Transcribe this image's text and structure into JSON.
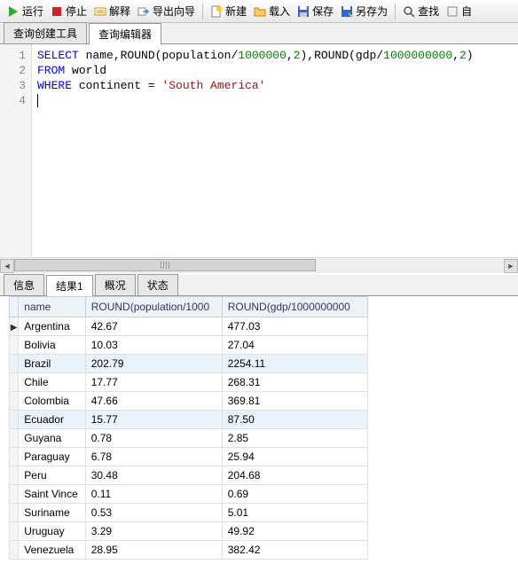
{
  "toolbar": {
    "run": "运行",
    "stop": "停止",
    "explain": "解释",
    "export_wizard": "导出向导",
    "new": "新建",
    "load": "载入",
    "save": "保存",
    "save_as": "另存为",
    "find": "查找",
    "auto": "自"
  },
  "editor_tabs": {
    "builder": "查询创建工具",
    "editor": "查询编辑器"
  },
  "sql": {
    "line1": {
      "select": "SELECT",
      "name": " name,",
      "round1": "ROUND",
      "p1": "(population/",
      "n1": "1000000",
      "c1": ",",
      "n2": "2",
      "p2": "),",
      "round2": "ROUND",
      "p3": "(gdp/",
      "n3": "1000000000",
      "c2": ",",
      "n4": "2",
      "p4": ")"
    },
    "line2": {
      "from": "FROM",
      "tbl": " world"
    },
    "line3": {
      "where": "WHERE",
      "col": " continent = ",
      "val": "'South America'"
    },
    "lines": [
      "1",
      "2",
      "3",
      "4"
    ]
  },
  "result_tabs": {
    "info": "信息",
    "result1": "结果1",
    "overview": "概况",
    "status": "状态"
  },
  "grid": {
    "columns": [
      "name",
      "ROUND(population/1000",
      "ROUND(gdp/1000000000"
    ],
    "rows": [
      {
        "name": "Argentina",
        "pop": "42.67",
        "gdp": "477.03",
        "ptr": true
      },
      {
        "name": "Bolivia",
        "pop": "10.03",
        "gdp": "27.04"
      },
      {
        "name": "Brazil",
        "pop": "202.79",
        "gdp": "2254.11"
      },
      {
        "name": "Chile",
        "pop": "17.77",
        "gdp": "268.31"
      },
      {
        "name": "Colombia",
        "pop": "47.66",
        "gdp": "369.81"
      },
      {
        "name": "Ecuador",
        "pop": "15.77",
        "gdp": "87.50"
      },
      {
        "name": "Guyana",
        "pop": "0.78",
        "gdp": "2.85"
      },
      {
        "name": "Paraguay",
        "pop": "6.78",
        "gdp": "25.94"
      },
      {
        "name": "Peru",
        "pop": "30.48",
        "gdp": "204.68"
      },
      {
        "name": "Saint Vince",
        "pop": "0.11",
        "gdp": "0.69"
      },
      {
        "name": "Suriname",
        "pop": "0.53",
        "gdp": "5.01"
      },
      {
        "name": "Uruguay",
        "pop": "3.29",
        "gdp": "49.92"
      },
      {
        "name": "Venezuela",
        "pop": "28.95",
        "gdp": "382.42"
      }
    ]
  }
}
